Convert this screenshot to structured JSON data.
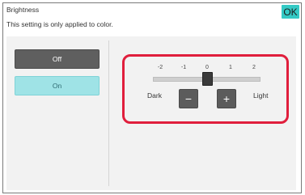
{
  "dialog": {
    "title": "Brightness",
    "subtitle": "This setting is only applied to color.",
    "ok_label": "OK"
  },
  "options": {
    "off_label": "Off",
    "on_label": "On",
    "selected": "On"
  },
  "brightness": {
    "ticks": [
      "-2",
      "-1",
      "0",
      "1",
      "2"
    ],
    "value": 0,
    "min_label": "Dark",
    "max_label": "Light",
    "decrease_icon": "minus-icon",
    "increase_icon": "plus-icon"
  },
  "colors": {
    "accent": "#34c9c4",
    "selected_option": "#9fe3e6",
    "highlight": "#e01e3c"
  }
}
